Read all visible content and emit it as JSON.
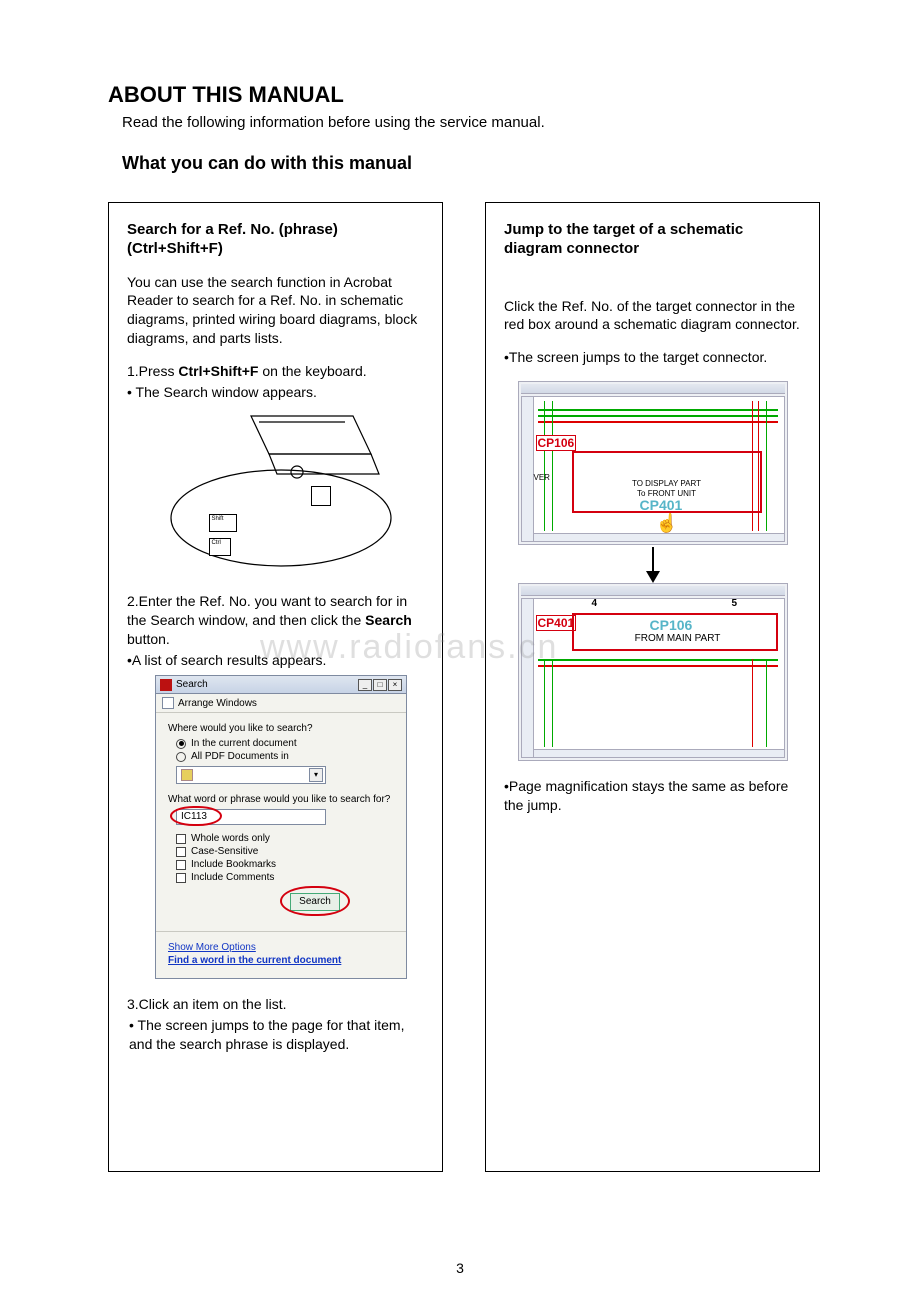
{
  "page_number": "3",
  "watermark": "www.radiofans.cn",
  "heading_main": "ABOUT THIS MANUAL",
  "intro_text": "Read the following information before using the service manual.",
  "heading_sub": "What you can do with this manual",
  "left": {
    "title_line1": "Search for a Ref. No. (phrase)",
    "title_line2": "(Ctrl+Shift+F)",
    "para1": "You can use the search function in Acrobat Reader to search for a Ref. No. in schematic diagrams, printed wiring board diagrams, block diagrams, and parts lists.",
    "step1_pre": "1.Press ",
    "step1_bold": "Ctrl+Shift+F",
    "step1_post": " on the keyboard.",
    "bullet1": "•    The Search window appears.",
    "key_shift": "Shift",
    "key_ctrl": "Ctrl",
    "step2_pre": "2.Enter the Ref. No. you want to search for in the Search window, and then click the ",
    "step2_bold": "Search",
    "step2_post": " button.",
    "bullet2": "•A list of search results appears.",
    "dialog": {
      "title": "Search",
      "arrange": "Arrange Windows",
      "where_q": "Where would you like to search?",
      "radio_current": "In the current document",
      "radio_all": "All PDF Documents in",
      "phrase_q": "What word or phrase would you like to search for?",
      "phrase_value": "IC113",
      "chk_whole": "Whole words only",
      "chk_case": "Case-Sensitive",
      "chk_bookmarks": "Include Bookmarks",
      "chk_comments": "Include Comments",
      "btn_search": "Search",
      "link_more": "Show More Options",
      "link_find": "Find a word in the current document"
    },
    "step3": "3.Click an item on the list.",
    "bullet3": "• The screen jumps to the page for that item, and the search phrase is displayed."
  },
  "right": {
    "title_line1": "Jump to the target of a schematic",
    "title_line2": "diagram connector",
    "para1": "Click the Ref. No. of the target connector in the red box around a schematic diagram connector.",
    "bullet1": "•The screen jumps to the target connector.",
    "cp106_label": "CP106",
    "cp401_label": "CP401",
    "diag_note1": "TO DISPLAY PART",
    "diag_note2": "To FRONT UNIT",
    "diag_link_top": "CP401",
    "diag_link_bot": "CP106",
    "diag_from": "FROM MAIN PART",
    "ver": "VER",
    "ruler_4": "4",
    "ruler_5": "5",
    "footer_note": "•Page magnification stays the same as before the jump."
  }
}
